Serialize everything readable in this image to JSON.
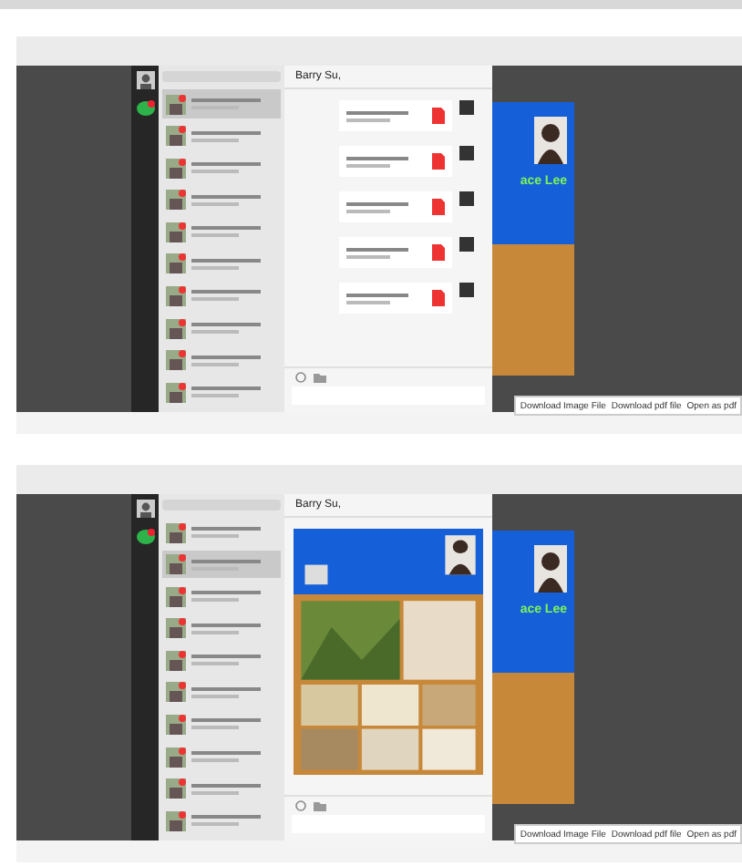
{
  "panels": [
    {
      "kind": "files",
      "chat_title": "Barry Su,",
      "flyer_name": "ace Lee",
      "chats": [
        {
          "selected": true
        },
        {
          "selected": false
        },
        {
          "selected": false
        },
        {
          "selected": false
        },
        {
          "selected": false
        },
        {
          "selected": false
        },
        {
          "selected": false
        },
        {
          "selected": false
        },
        {
          "selected": false
        },
        {
          "selected": false
        }
      ],
      "messages": [
        {
          "kind": "pdf"
        },
        {
          "kind": "pdf"
        },
        {
          "kind": "pdf"
        },
        {
          "kind": "pdf"
        },
        {
          "kind": "pdf"
        }
      ],
      "download_links": [
        "Download Image File",
        "Download pdf file",
        "Open as pdf"
      ]
    },
    {
      "kind": "flyer",
      "chat_title": "Barry Su,",
      "flyer_name": "ace Lee",
      "chats": [
        {
          "selected": false
        },
        {
          "selected": true
        },
        {
          "selected": false
        },
        {
          "selected": false
        },
        {
          "selected": false
        },
        {
          "selected": false
        },
        {
          "selected": false
        },
        {
          "selected": false
        },
        {
          "selected": false
        },
        {
          "selected": false
        }
      ],
      "download_links": [
        "Download Image File",
        "Download pdf file",
        "Open as pdf"
      ]
    }
  ]
}
